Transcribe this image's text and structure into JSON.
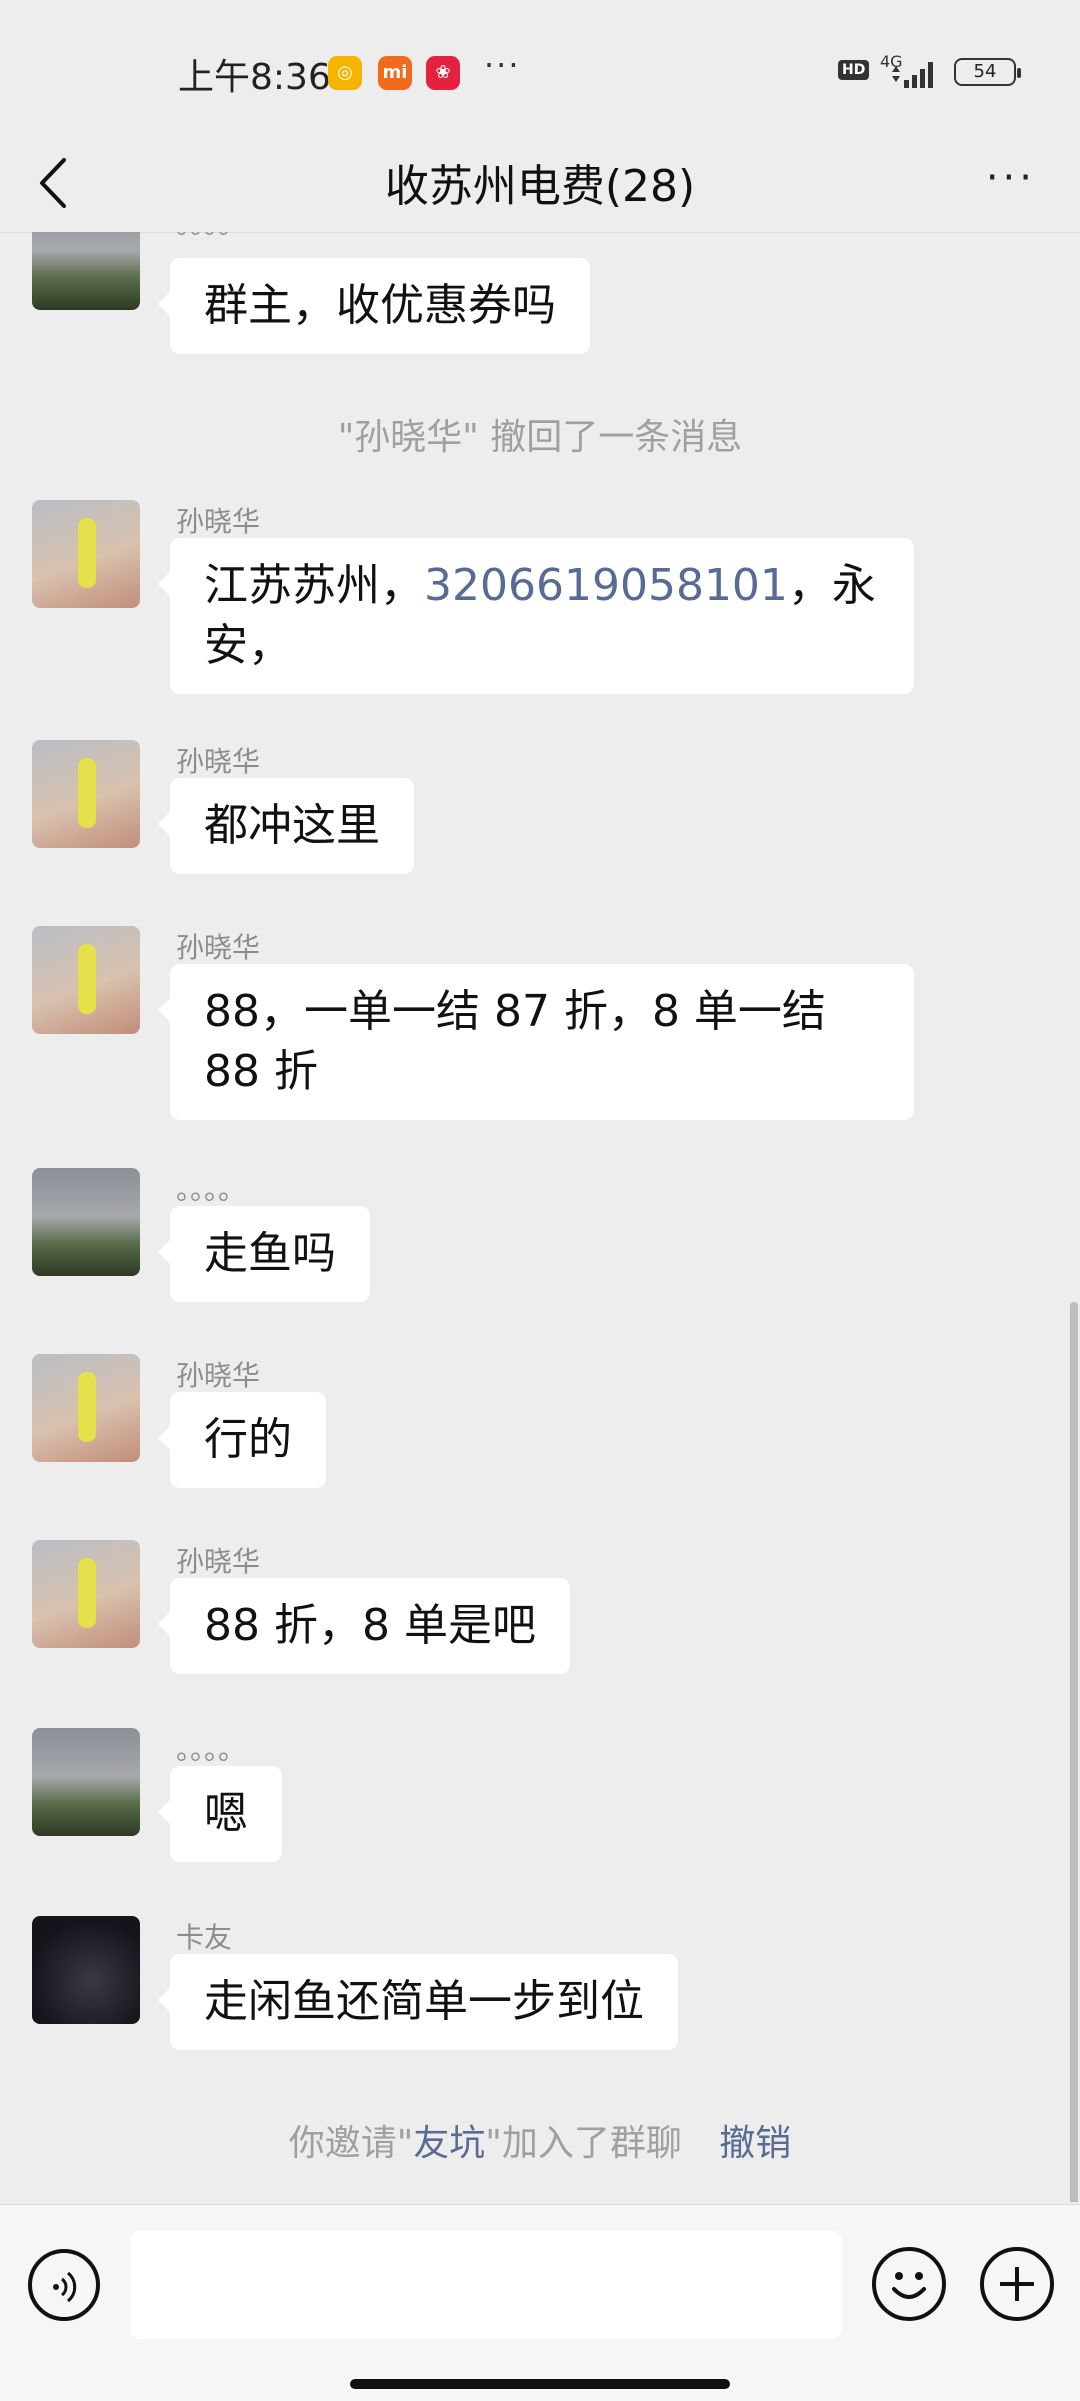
{
  "status_bar": {
    "time": "上午8:36",
    "network": "4G",
    "hd": "HD",
    "battery": "54",
    "more": "···"
  },
  "header": {
    "title": "收苏州电费(28)",
    "menu": "···"
  },
  "messages": [
    {
      "type": "msg",
      "sender": "。。。。",
      "avatar": "sunset",
      "text": "群主，收优惠券吗"
    },
    {
      "type": "system",
      "text": "\"孙晓华\" 撤回了一条消息"
    },
    {
      "type": "msg",
      "sender": "孙晓华",
      "avatar": "kid",
      "text_parts": [
        "江苏苏州，",
        "3206619058101",
        "，永安，"
      ]
    },
    {
      "type": "msg",
      "sender": "孙晓华",
      "avatar": "kid",
      "text": "都冲这里"
    },
    {
      "type": "msg",
      "sender": "孙晓华",
      "avatar": "kid",
      "text": "88，一单一结 87 折，8 单一结 88 折"
    },
    {
      "type": "msg",
      "sender": "。。。。",
      "avatar": "sunset",
      "text": "走鱼吗"
    },
    {
      "type": "msg",
      "sender": "孙晓华",
      "avatar": "kid",
      "text": "行的"
    },
    {
      "type": "msg",
      "sender": "孙晓华",
      "avatar": "kid",
      "text": "88 折，8 单是吧"
    },
    {
      "type": "msg",
      "sender": "。。。。",
      "avatar": "sunset",
      "text": "嗯"
    },
    {
      "type": "msg",
      "sender": "卡友",
      "avatar": "dark",
      "text": "走闲鱼还简单一步到位"
    }
  ],
  "invite_notice": {
    "prefix": "你邀请\"",
    "name": "友坑",
    "suffix": "\"加入了群聊",
    "action": "撤销"
  },
  "input_bar": {
    "text": ""
  }
}
